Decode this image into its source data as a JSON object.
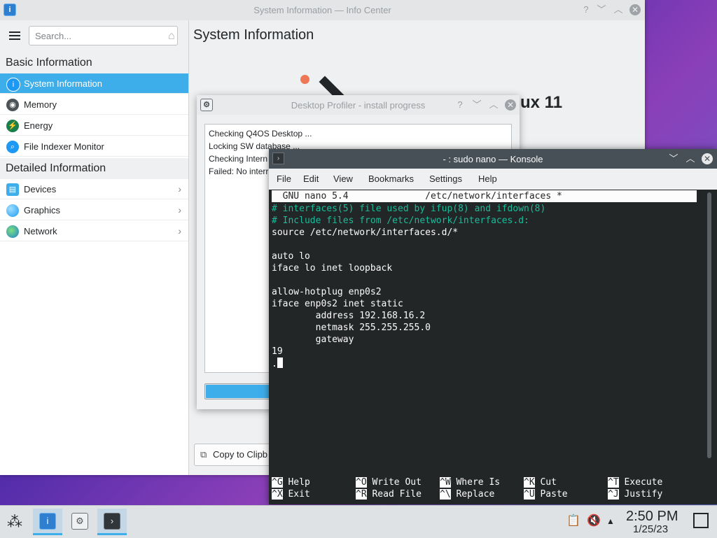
{
  "infocenter": {
    "title": "System Information — Info Center",
    "search_placeholder": "Search...",
    "content_title": "System Information",
    "content_partial": "ux 11",
    "sections": [
      {
        "header": "Basic Information",
        "items": [
          "System Information",
          "Memory",
          "Energy",
          "File Indexer Monitor"
        ]
      },
      {
        "header": "Detailed Information",
        "items": [
          "Devices",
          "Graphics",
          "Network"
        ]
      }
    ]
  },
  "profiler": {
    "title": "Desktop Profiler - install progress",
    "log": [
      "Checking Q4OS Desktop ...",
      "Locking SW database ...",
      "Checking Intern",
      "Failed: No interr"
    ],
    "progress": 0.21,
    "copy_label": "Copy to Clipb"
  },
  "konsole": {
    "title": "- : sudo nano — Konsole",
    "menu": [
      "File",
      "Edit",
      "View",
      "Bookmarks",
      "Settings",
      "Help"
    ],
    "nano_header": "  GNU nano 5.4              /etc/network/interfaces *",
    "lines": [
      "# interfaces(5) file used by ifup(8) and ifdown(8)",
      "# Include files from /etc/network/interfaces.d:",
      "source /etc/network/interfaces.d/*",
      "",
      "auto lo",
      "iface lo inet loopback",
      "",
      "allow-hotplug enp0s2",
      "iface enp0s2 inet static",
      "        address 192.168.16.2",
      "        netmask 255.255.255.0",
      "        gateway",
      "19",
      "."
    ],
    "shortcuts": [
      [
        {
          "key": "^G",
          "label": "Help"
        },
        {
          "key": "^O",
          "label": "Write Out"
        },
        {
          "key": "^W",
          "label": "Where Is"
        },
        {
          "key": "^K",
          "label": "Cut"
        },
        {
          "key": "^T",
          "label": "Execute"
        }
      ],
      [
        {
          "key": "^X",
          "label": "Exit"
        },
        {
          "key": "^R",
          "label": "Read File"
        },
        {
          "key": "^\\",
          "label": "Replace"
        },
        {
          "key": "^U",
          "label": "Paste"
        },
        {
          "key": "^J",
          "label": "Justify"
        }
      ]
    ]
  },
  "taskbar": {
    "time": "2:50 PM",
    "date": "1/25/23"
  },
  "colors": {
    "accent": "#3daee9",
    "comment": "#1abc9c",
    "terminal_bg": "#232627"
  }
}
